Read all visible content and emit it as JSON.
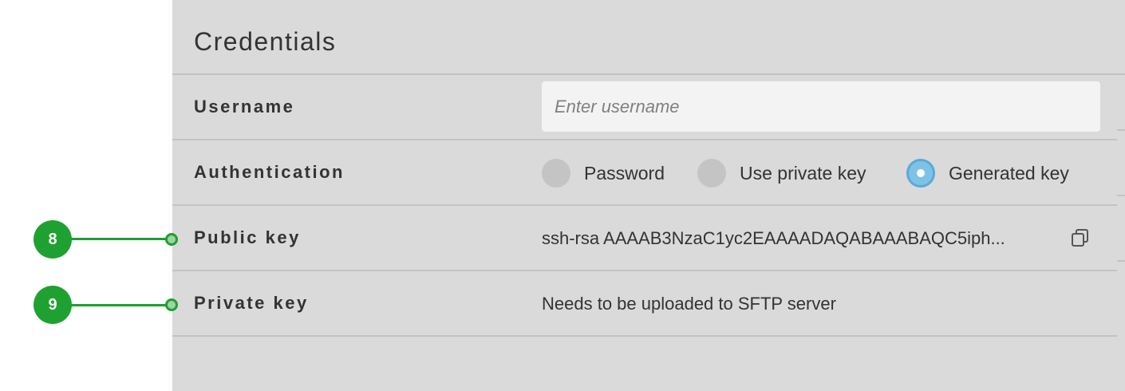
{
  "section": {
    "title": "Credentials"
  },
  "username": {
    "label": "Username",
    "placeholder": "Enter username"
  },
  "authentication": {
    "label": "Authentication",
    "options": [
      {
        "label": "Password",
        "checked": false
      },
      {
        "label": "Use private key",
        "checked": false
      },
      {
        "label": "Generated key",
        "checked": true
      }
    ]
  },
  "public_key": {
    "label": "Public key",
    "value": "ssh-rsa AAAAB3NzaC1yc2EAAAADAQABAAABAQC5iph..."
  },
  "private_key": {
    "label": "Private key",
    "value": "Needs to be uploaded to SFTP server"
  },
  "callouts": [
    "8",
    "9"
  ],
  "colors": {
    "accent_radio": "#7ec3e6",
    "callout_green": "#1ea130",
    "panel_bg": "#dadada"
  }
}
